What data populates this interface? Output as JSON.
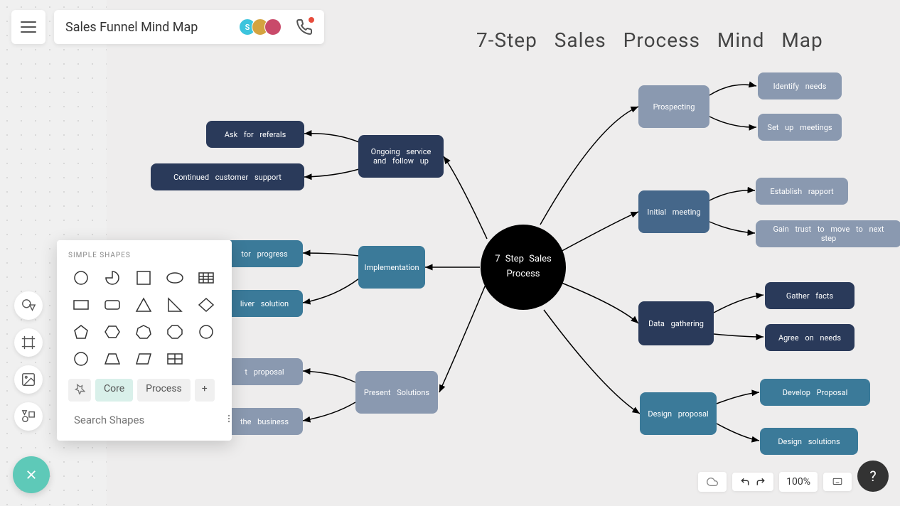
{
  "header": {
    "title": "Sales Funnel Mind Map",
    "avatars": [
      {
        "initial": "S",
        "color": "#3cc4dd"
      },
      {
        "initial": "",
        "color": "#d4a340"
      },
      {
        "initial": "",
        "color": "#c94a6a"
      }
    ]
  },
  "mindmap": {
    "title": "7-Step Sales Process Mind Map",
    "center": "7 Step Sales Process",
    "nodes": {
      "prospecting": {
        "label": "Prospecting",
        "children": [
          "Identify needs",
          "Set up meetings"
        ]
      },
      "initial_meeting": {
        "label": "Initial meeting",
        "children": [
          "Establish rapport",
          "Gain trust to move to next step"
        ]
      },
      "data_gathering": {
        "label": "Data gathering",
        "children": [
          "Gather facts",
          "Agree on needs"
        ]
      },
      "design_proposal": {
        "label": "Design proposal",
        "children": [
          "Develop Proposal",
          "Design solutions"
        ]
      },
      "present_solutions": {
        "label": "Present Solutions",
        "children": [
          "t proposal",
          "the business"
        ]
      },
      "implementation": {
        "label": "Implementation",
        "children": [
          "tor progress",
          "liver solution"
        ]
      },
      "ongoing": {
        "label": "Ongoing service and follow up",
        "children": [
          "Ask for referals",
          "Continued customer support"
        ]
      }
    }
  },
  "shapes_panel": {
    "title": "SIMPLE SHAPES",
    "tabs": {
      "core": "Core",
      "process": "Process"
    },
    "search_placeholder": "Search Shapes"
  },
  "bottom": {
    "zoom": "100%"
  },
  "colors": {
    "navy": "#2a3a5a",
    "steel": "#45678a",
    "slate": "#8a99b0",
    "teal": "#3b7a99"
  }
}
